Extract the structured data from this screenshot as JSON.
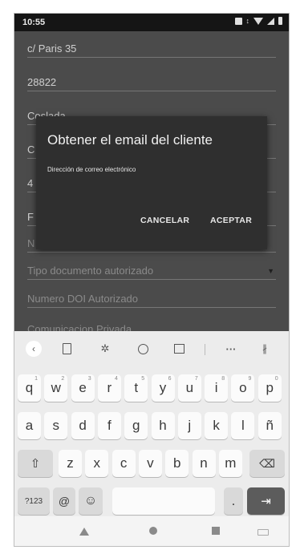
{
  "status": {
    "time": "10:55"
  },
  "form": {
    "fields": [
      "c/ Paris 35",
      "28822",
      "Coslada",
      "C",
      "4",
      "F",
      "N",
      "Tipo documento autorizado",
      "Numero DOI Autorizado",
      "Comunicacion Privada"
    ]
  },
  "dialog": {
    "title": "Obtener el email del cliente",
    "placeholder": "Dirección de correo electrónico",
    "cancel": "CANCELAR",
    "accept": "ACEPTAR"
  },
  "keyboard": {
    "row1": [
      "q",
      "w",
      "e",
      "r",
      "t",
      "y",
      "u",
      "i",
      "o",
      "p"
    ],
    "row1_numbers": [
      "1",
      "2",
      "3",
      "4",
      "5",
      "6",
      "7",
      "8",
      "9",
      "0"
    ],
    "row2": [
      "a",
      "s",
      "d",
      "f",
      "g",
      "h",
      "j",
      "k",
      "l",
      "ñ"
    ],
    "row3": [
      "z",
      "x",
      "c",
      "v",
      "b",
      "n",
      "m"
    ],
    "symbols_key": "?123",
    "at_key": "@",
    "period_key": ".",
    "more_label": "···"
  },
  "colors": {
    "dialog_bg": "#2f2f2f",
    "scrim": "#4b4b4b",
    "keyboard_bg": "#ececec"
  }
}
